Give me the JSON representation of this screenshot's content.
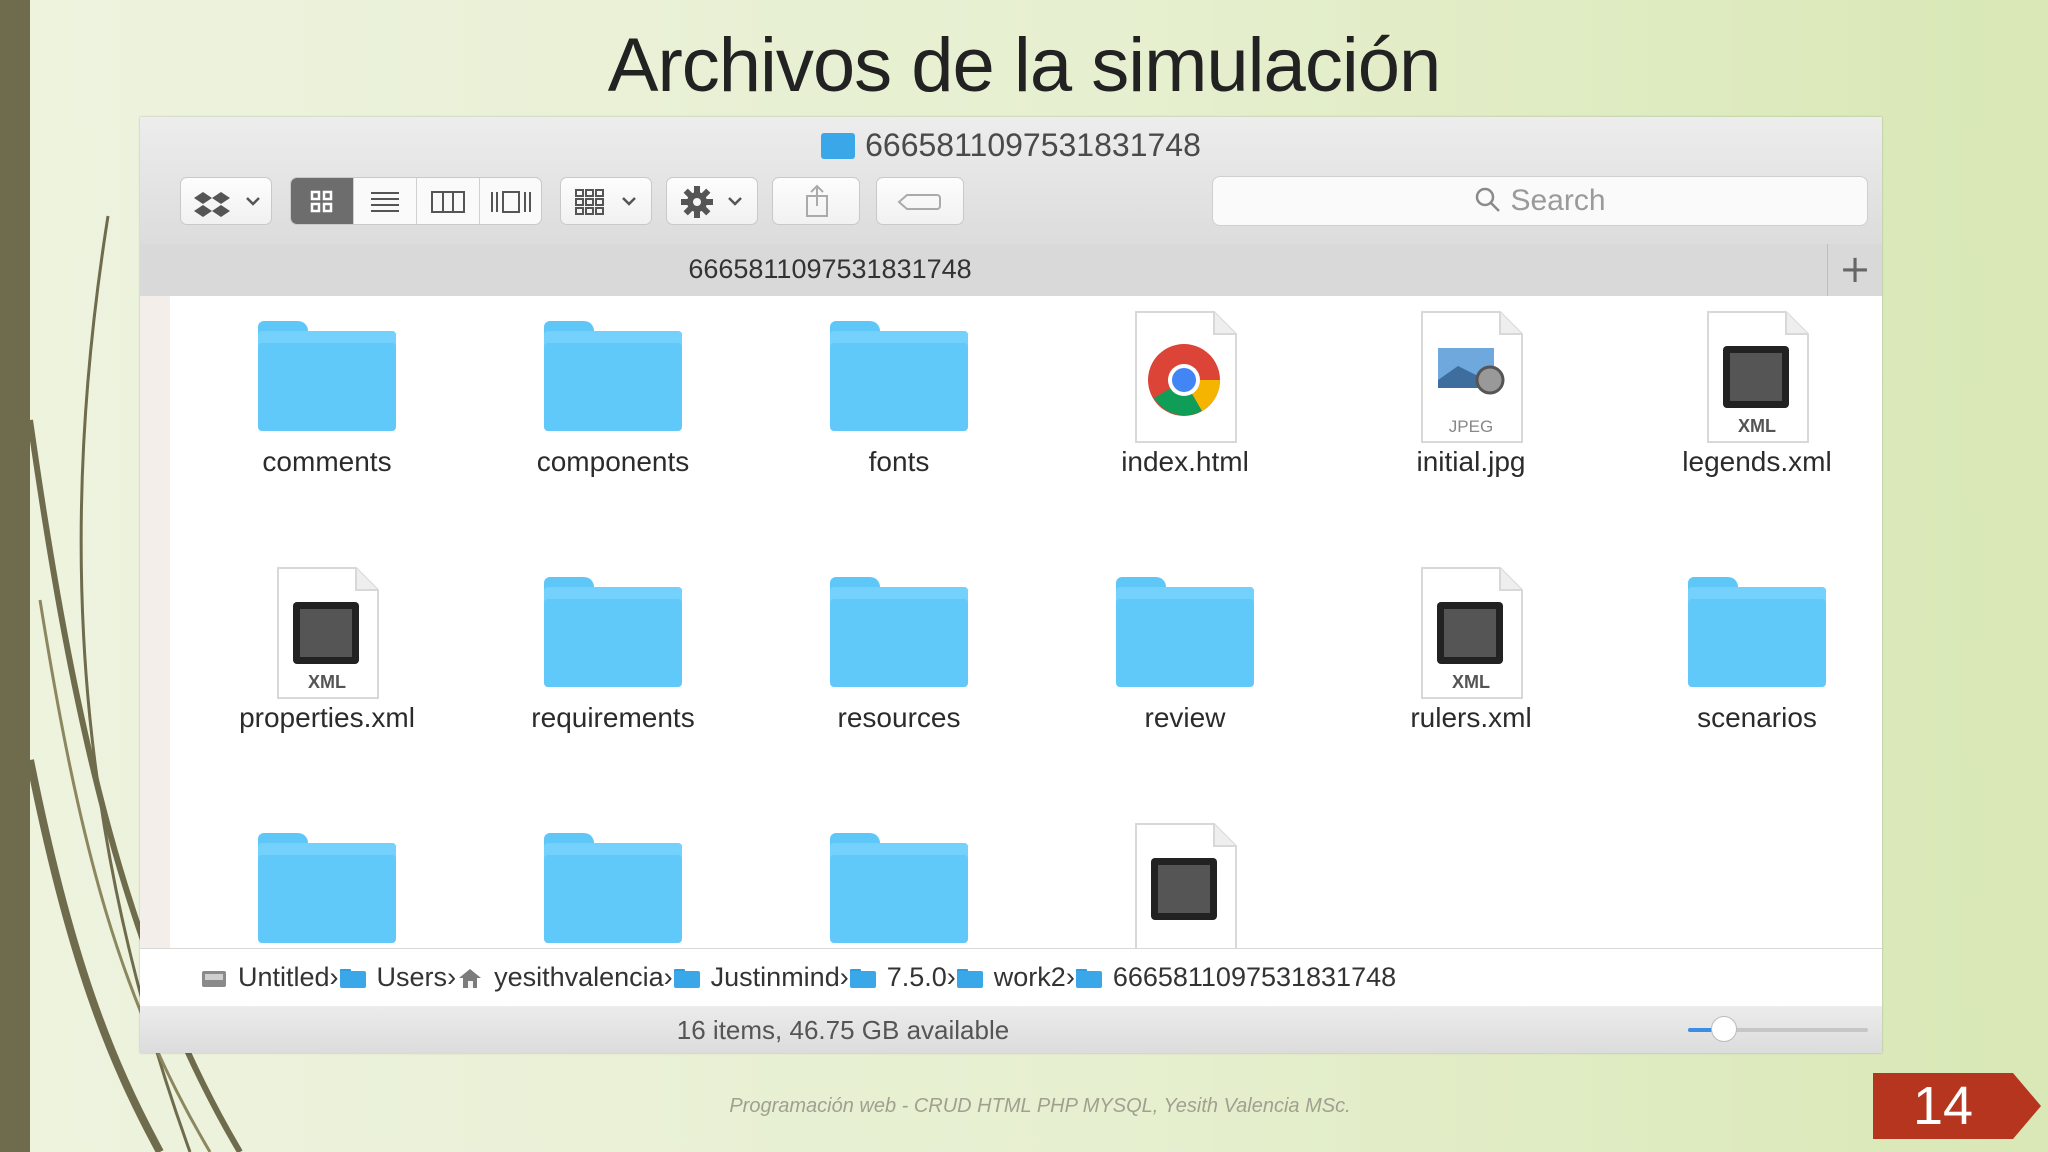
{
  "slide": {
    "title": "Archivos de la simulación",
    "footer": "Programación web - CRUD HTML PHP MYSQL, Yesith Valencia MSc.",
    "page_number": "14",
    "accent_color": "#b5351e"
  },
  "finder": {
    "window_title": "6665811097531831748",
    "tab_label": "6665811097531831748",
    "search_placeholder": "Search",
    "status": "16 items, 46.75 GB available",
    "icon_size_level": 0.2,
    "toolbar": {
      "dropbox": "dropbox-icon",
      "view_icons": "icon-view-icon",
      "view_list": "list-view-icon",
      "view_columns": "column-view-icon",
      "view_coverflow": "coverflow-view-icon",
      "arrange": "arrange-icon",
      "action": "gear-icon",
      "share": "share-icon",
      "tags": "tag-icon"
    },
    "items": [
      {
        "name": "comments",
        "kind": "folder"
      },
      {
        "name": "components",
        "kind": "folder"
      },
      {
        "name": "fonts",
        "kind": "folder"
      },
      {
        "name": "index.html",
        "kind": "chrome"
      },
      {
        "name": "initial.jpg",
        "kind": "jpeg",
        "badge": "JPEG"
      },
      {
        "name": "legends.xml",
        "kind": "xml",
        "badge": "XML"
      },
      {
        "name": "properties.xml",
        "kind": "xml",
        "badge": "XML"
      },
      {
        "name": "requirements",
        "kind": "folder"
      },
      {
        "name": "resources",
        "kind": "folder"
      },
      {
        "name": "review",
        "kind": "folder"
      },
      {
        "name": "rulers.xml",
        "kind": "xml",
        "badge": "XML"
      },
      {
        "name": "scenarios",
        "kind": "folder"
      },
      {
        "name": "",
        "kind": "folder"
      },
      {
        "name": "",
        "kind": "folder"
      },
      {
        "name": "",
        "kind": "folder"
      },
      {
        "name": "",
        "kind": "xml",
        "badge": ""
      }
    ],
    "path": [
      {
        "label": "Untitled",
        "icon": "disk-icon"
      },
      {
        "label": "Users",
        "icon": "folder-icon"
      },
      {
        "label": "yesithvalencia",
        "icon": "home-icon"
      },
      {
        "label": "Justinmind",
        "icon": "folder-icon"
      },
      {
        "label": "7.5.0",
        "icon": "folder-icon"
      },
      {
        "label": "work2",
        "icon": "folder-icon"
      },
      {
        "label": "6665811097531831748",
        "icon": "folder-icon"
      }
    ]
  }
}
